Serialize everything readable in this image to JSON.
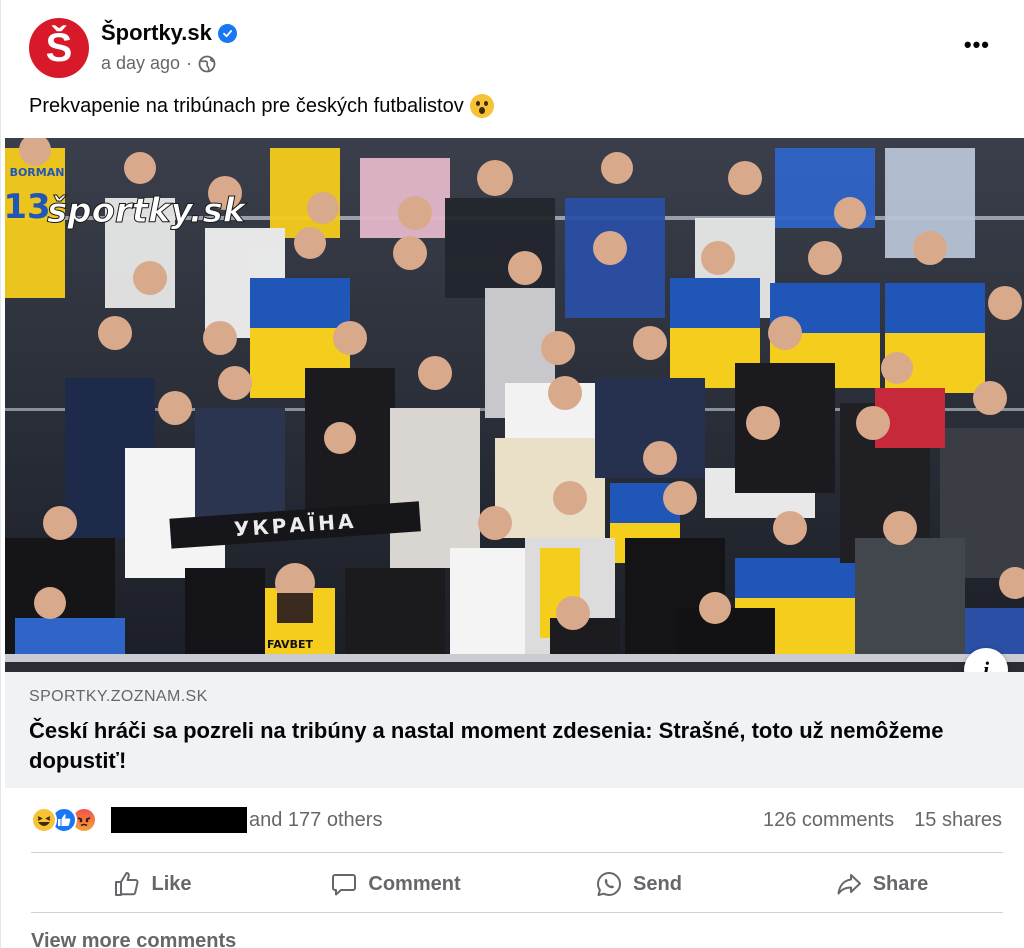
{
  "post": {
    "page_name": "Športky.sk",
    "avatar_letter": "Š",
    "time": "a day ago",
    "separator": "·",
    "caption": "Prekvapenie na tribúnach pre českých futbalistov",
    "photo_watermark": "športky.sk",
    "photo_jersey_name": "BORMAN",
    "photo_jersey_number": "13",
    "photo_scarf_text": "УКРАЇНА",
    "photo_shirt_text": "FAVBET"
  },
  "link": {
    "domain": "SPORTKY.ZOZNAM.SK",
    "title": "Českí hráči sa pozreli na tribúny a nastal moment zdesenia: Strašné, toto už nemôžeme dopustiť!",
    "info_label": "i"
  },
  "stats": {
    "others": "and 177 others",
    "comments": "126 comments",
    "shares": "15 shares"
  },
  "actions": {
    "like": "Like",
    "comment": "Comment",
    "send": "Send",
    "share": "Share"
  },
  "footer": {
    "view_more": "View more comments"
  },
  "colors": {
    "brand_red": "#d8192a",
    "facebook_blue": "#1877f2",
    "ukraine_blue": "#1f56b8",
    "ukraine_yellow": "#f5cd1c"
  }
}
